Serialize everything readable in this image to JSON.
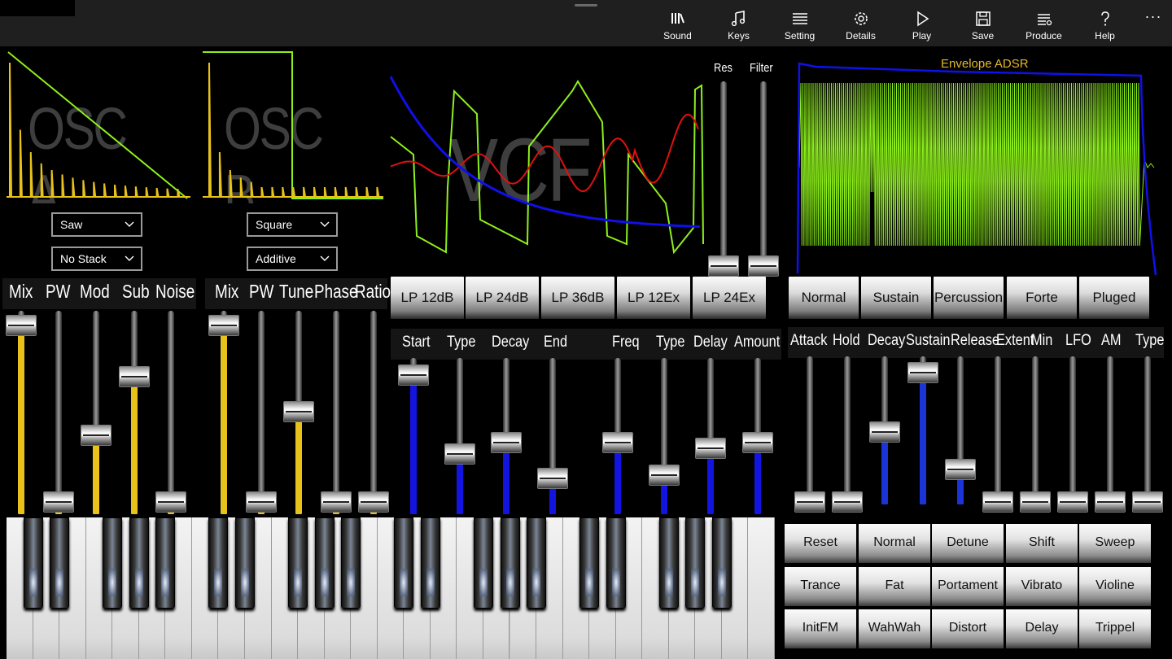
{
  "toolbar": {
    "items": [
      {
        "label": "Sound",
        "icon": "library-icon"
      },
      {
        "label": "Keys",
        "icon": "music-note-icon"
      },
      {
        "label": "Setting",
        "icon": "list-icon"
      },
      {
        "label": "Details",
        "icon": "gear-icon"
      },
      {
        "label": "Play",
        "icon": "play-icon"
      },
      {
        "label": "Save",
        "icon": "save-icon"
      },
      {
        "label": "Produce",
        "icon": "produce-icon"
      },
      {
        "label": "Help",
        "icon": "help-icon"
      }
    ],
    "more_label": "···"
  },
  "osc_a": {
    "title": "OSC A",
    "waveform": "Saw",
    "stack": "No Stack",
    "labels": [
      "Mix",
      "PW",
      "Mod",
      "Sub",
      "Noise"
    ],
    "levels": [
      0.96,
      0.06,
      0.4,
      0.7,
      0.06
    ]
  },
  "osc_b": {
    "title": "OSC B",
    "waveform": "Square",
    "mode": "Additive",
    "labels": [
      "Mix",
      "PW",
      "Tune",
      "Phase",
      "Ratio"
    ],
    "levels": [
      0.96,
      0.06,
      0.52,
      0.06,
      0.06
    ]
  },
  "vcf": {
    "title": "VCF",
    "res_label": "Res",
    "filter_label": "Filter",
    "res_level": 0.04,
    "filter_level": 0.04,
    "filter_types": [
      "LP 12dB",
      "LP 24dB",
      "LP 36dB",
      "LP 12Ex",
      "LP 24Ex"
    ],
    "env_labels": [
      "Start",
      "Type",
      "Decay",
      "End",
      "Freq",
      "Type",
      "Delay",
      "Amount"
    ],
    "env_levels": [
      0.93,
      0.4,
      0.48,
      0.24,
      0.48,
      0.26,
      0.44,
      0.48
    ]
  },
  "envelope": {
    "title": "Envelope ADSR",
    "modes": [
      "Normal",
      "Sustain",
      "Percussion",
      "Forte",
      "Pluged"
    ],
    "labels": [
      "Attack",
      "Hold",
      "Decay",
      "Sustain",
      "Release",
      "Extent",
      "Min",
      "LFO",
      "AM",
      "Type"
    ],
    "levels": [
      0.02,
      0.02,
      0.51,
      0.93,
      0.25,
      0.02,
      0.02,
      0.02,
      0.02,
      0.02
    ]
  },
  "presets": {
    "rows": [
      [
        "Reset",
        "Normal",
        "Detune",
        "Shift",
        "Sweep"
      ],
      [
        "Trance",
        "Fat",
        "Portament",
        "Vibrato",
        "Violine"
      ],
      [
        "InitFM",
        "WahWah",
        "Distort",
        "Delay",
        "Trippel"
      ]
    ]
  },
  "colors": {
    "osc": "#e8c21a",
    "vcf": "#1414e0",
    "env_fill": "#1b34d8",
    "green": "#8ef01c",
    "red": "#e01010",
    "blue": "#1010e8",
    "label_yellow": "#e5b82a"
  }
}
